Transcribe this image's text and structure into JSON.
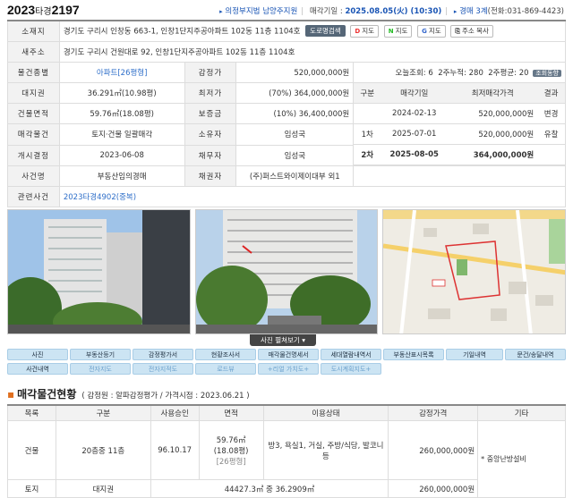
{
  "header": {
    "case_no": "2023",
    "case_type": "타경",
    "case_num": "2197",
    "court": "의정부지법 남양주지원",
    "sale_date_label": "매각기일 :",
    "sale_date": "2025.08.05(火) (10:30)",
    "dept": "경매 3계",
    "phone": "(전화:031-869-4423)"
  },
  "info": {
    "lot_address_label": "소재지",
    "lot_address": "경기도 구리시 인창동 663-1, 인창1단지주공아파트 102동 11층 1104호",
    "btn_road": "도로명검색",
    "btn_map_d": "지도",
    "btn_map_n": "지도",
    "btn_map_g": "지도",
    "btn_copy": "주소 복사",
    "road_address_label": "새주소",
    "road_address": "경기도 구리시 건원대로 92, 인창1단지주공아파트 102동 11층 1104호",
    "type_label": "물건종별",
    "type": "아파트",
    "type_sub": "[26평형]",
    "appraisal_label": "감정가",
    "appraisal": "520,000,000원",
    "views_label": "오늘조회:",
    "views_today": "6",
    "views_2w_label": "2주누적:",
    "views_2w": "280",
    "views_avg_label": "2주평균:",
    "views_avg": "20",
    "views_btn": "조회동향",
    "land_label": "대지권",
    "land": "36.291㎡(10.98평)",
    "min_label": "최저가",
    "min": "(70%) 364,000,000원",
    "area_label": "건물면적",
    "area": "59.76㎡(18.08평)",
    "deposit_label": "보증금",
    "deposit": "(10%) 36,400,000원",
    "sale_obj_label": "매각물건",
    "sale_obj": "토지·건물 일괄매각",
    "owner_label": "소유자",
    "owner": "임성국",
    "start_label": "개시결정",
    "start": "2023-06-08",
    "debtor_label": "채무자",
    "debtor": "임성국",
    "case_name_label": "사건명",
    "case_name": "부동산임의경매",
    "creditor_label": "채권자",
    "creditor": "(주)퍼스트와이제이대부 외1",
    "related_label": "관련사건",
    "related": "2023타경4902(중복)"
  },
  "history": {
    "headers": [
      "구분",
      "매각기일",
      "최저매각가격",
      "결과"
    ],
    "rows": [
      [
        "",
        "2024-02-13",
        "520,000,000원",
        "변경"
      ],
      [
        "1차",
        "2025-07-01",
        "520,000,000원",
        "유찰"
      ],
      [
        "2차",
        "2025-08-05",
        "364,000,000원",
        ""
      ]
    ]
  },
  "photos_more": "사진 펼쳐보기",
  "links": [
    "사진",
    "부동산등기",
    "감정평가서",
    "현황조사서",
    "매각물건명세서",
    "세대열람내역서",
    "부동산표시목록",
    "기일내역",
    "문건/송달내역",
    "사건내역",
    "전자지도",
    "전자지적도",
    "로드뷰",
    "+리얼 가치도+",
    "도시계획지도+"
  ],
  "section": {
    "title": "매각물건현황",
    "sub": "( 감정원 : 알파감정평가 / 가격시점 : 2023.06.21 )"
  },
  "t2": {
    "headers": [
      "목록",
      "구분",
      "사용승인",
      "면적",
      "이용상태",
      "감정가격",
      "기타"
    ],
    "building": {
      "label": "건물",
      "kind": "20층중 11층",
      "approved": "96.10.17",
      "area1": "59.76㎡",
      "area2": "(18.08평)",
      "area3": "[26평형]",
      "use": "방3, 욕실1, 거실, 주방/식당, 발코니 등",
      "price": "260,000,000원",
      "etc": "* 중앙난방설비"
    },
    "land": {
      "label": "토지",
      "kind": "대지권",
      "area": "44427.3㎡ 중 36.2909㎡",
      "price": "260,000,000원"
    }
  }
}
